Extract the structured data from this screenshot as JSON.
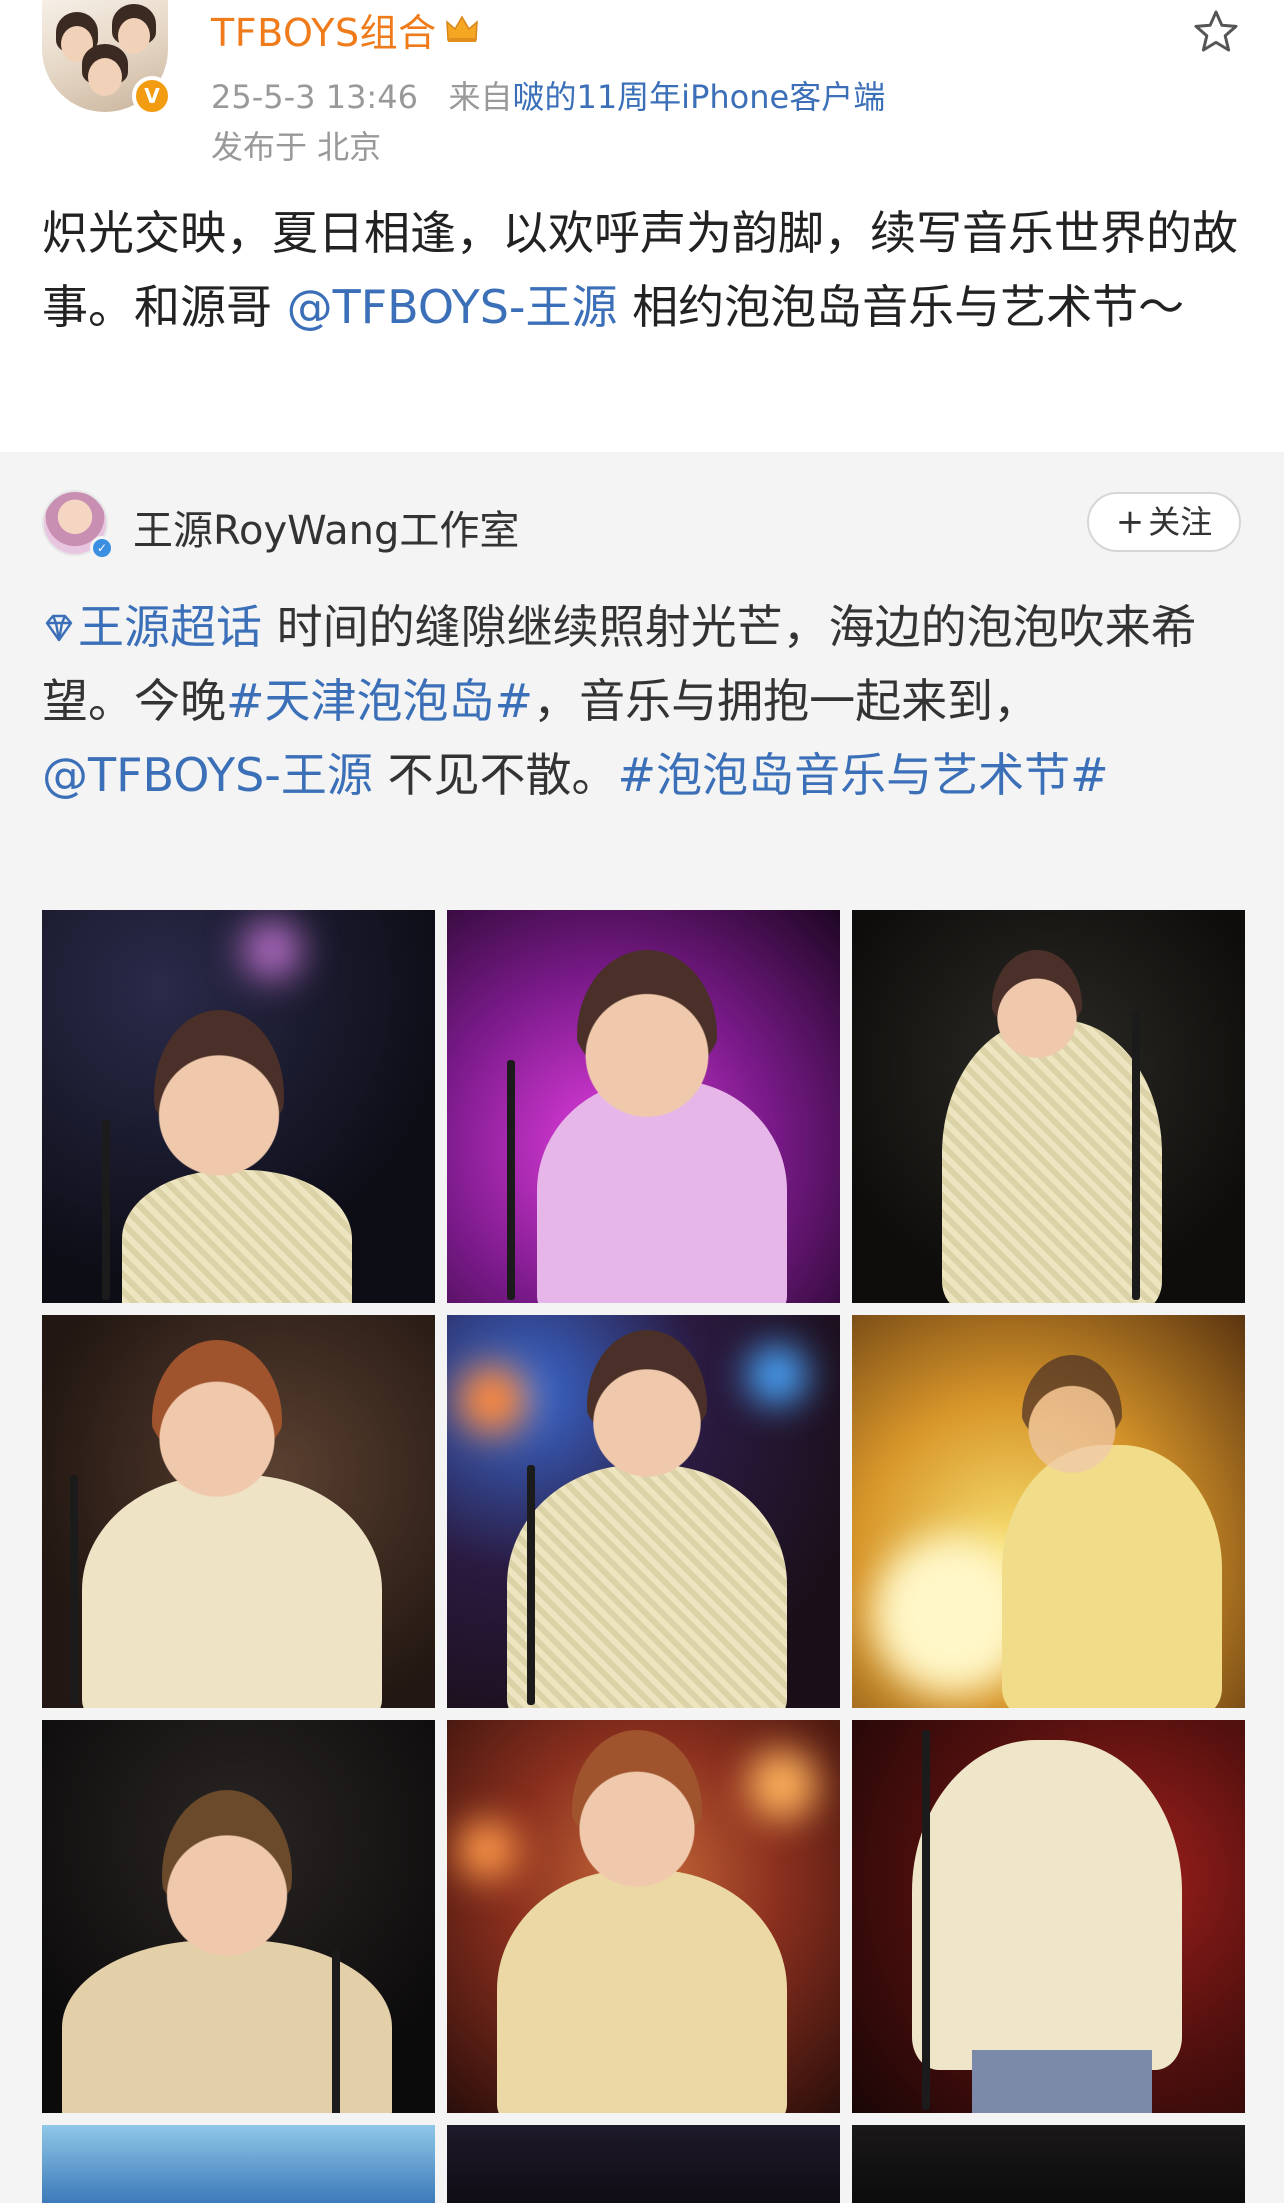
{
  "post": {
    "author": "TFBOYS组合",
    "time": "25-5-3 13:46",
    "source_prefix": "来自",
    "source": "啵的11周年iPhone客户端",
    "location": "发布于 北京",
    "text_part1": "炽光交映，夏日相逢，以欢呼声为韵脚，续写音乐世界的故事。和源哥 ",
    "mention": "@TFBOYS-王源",
    "text_part2": " 相约泡泡岛音乐与艺术节～"
  },
  "repost": {
    "author": "王源RoyWang工作室",
    "follow_label": "关注",
    "follow_icon": "+",
    "topic": "王源超话",
    "text_a": "  时间的缝隙继续照射光芒，海边的泡泡吹来希望。今晚",
    "hashtag1": "#天津泡泡岛#",
    "text_b": "，音乐与拥抱一起来到，",
    "mention": "@TFBOYS-王源",
    "text_c": " 不见不散。",
    "hashtag2": "#泡泡岛音乐与艺术节#"
  },
  "colors": {
    "author_orange": "#f07b1b",
    "link_blue": "#3b6fb8",
    "repost_bg": "#f4f4f4",
    "meta_gray": "#999999"
  },
  "icons": [
    "crown-icon",
    "verified-badge-icon",
    "star-icon",
    "diamond-topic-icon",
    "plus-icon"
  ],
  "photos": [
    {
      "name": "photo-1",
      "theme": "dark blue stage, mic"
    },
    {
      "name": "photo-2",
      "theme": "magenta light, head bowed"
    },
    {
      "name": "photo-3",
      "theme": "dark stage, standing with mic"
    },
    {
      "name": "photo-4",
      "theme": "warm amber, touching earpiece"
    },
    {
      "name": "photo-5",
      "theme": "bokeh lights, singing"
    },
    {
      "name": "photo-6",
      "theme": "golden haze, blurred"
    },
    {
      "name": "photo-7",
      "theme": "dark, hand near face"
    },
    {
      "name": "photo-8",
      "theme": "orange bokeh, singing"
    },
    {
      "name": "photo-9",
      "theme": "red stage, full body"
    },
    {
      "name": "photo-10",
      "theme": "blue, cropped"
    },
    {
      "name": "photo-11",
      "theme": "dark, cropped"
    },
    {
      "name": "photo-12",
      "theme": "dark, cropped"
    }
  ]
}
